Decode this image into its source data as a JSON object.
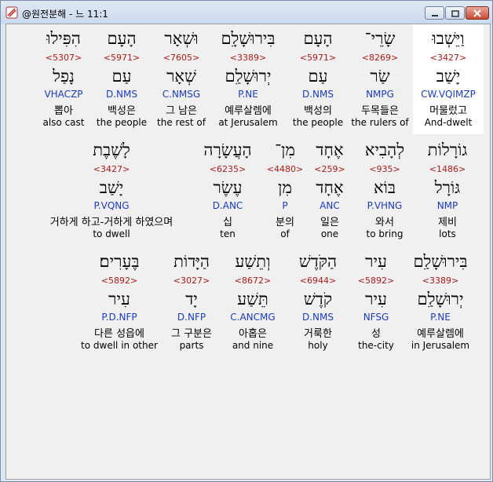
{
  "window": {
    "title": "@원전분해 - 느 11:1",
    "buttons": {
      "minimize": "minimize-icon",
      "maximize": "maximize-icon",
      "close": "close-icon"
    }
  },
  "colors": {
    "strong": "#b01818",
    "morph": "#1a3bc4",
    "selected_bg": "#ffffff",
    "content_bg": "#f0f0f0"
  },
  "rows": [
    {
      "words": [
        {
          "heb": "וַיֵּשְׁבוּ",
          "strong": "<3427>",
          "lemma": "יָשַׁב",
          "morph": "CW.VQIMZP",
          "korean": "머물렀고",
          "english": "And-dwelt",
          "selected": true
        },
        {
          "heb": "שָׂרֵי־",
          "strong": "<8269>",
          "lemma": "שַׂר",
          "morph": "NMPG",
          "korean": "두목들은",
          "english": "the rulers of"
        },
        {
          "heb": "הָעָם",
          "strong": "<5971>",
          "lemma": "עַם",
          "morph": "D.NMS",
          "korean": "백성의",
          "english": "the people"
        },
        {
          "heb": "בִּירוּשָׁלָ͏ִם",
          "strong": "<3389>",
          "lemma": "יְרוּשָׁלַ͏ִם",
          "morph": "P.NE",
          "korean": "예루살렘에",
          "english": "at Jerusalem"
        },
        {
          "heb": "וּשְׁאָר",
          "strong": "<7605>",
          "lemma": "שְׁאָר",
          "morph": "C.NMSG",
          "korean": "그 남은",
          "english": "the rest of"
        },
        {
          "heb": "הָעָם",
          "strong": "<5971>",
          "lemma": "עַם",
          "morph": "D.NMS",
          "korean": "백성은",
          "english": "the people"
        },
        {
          "heb": "הִפִּילוּ",
          "strong": "<5307>",
          "lemma": "נָפַל",
          "morph": "VHACZP",
          "korean": "뽑아",
          "english": "also cast"
        }
      ]
    },
    {
      "words": [
        {
          "heb": "גוֹרָלוֹת",
          "strong": "<1486>",
          "lemma": "גּוֹרָל",
          "morph": "NMP",
          "korean": "제비",
          "english": "lots"
        },
        {
          "heb": "לְהָבִיא",
          "strong": "<935>",
          "lemma": "בּוֹא",
          "morph": "P.VHNG",
          "korean": "와서",
          "english": "to bring"
        },
        {
          "heb": "אֶחָד",
          "strong": "<259>",
          "lemma": "אֶחָד",
          "morph": "ANC",
          "korean": "일은",
          "english": "one"
        },
        {
          "heb": "מִן־",
          "strong": "<4480>",
          "lemma": "מִן",
          "morph": "P",
          "korean": "분의",
          "english": "of"
        },
        {
          "heb": "הָעֲשָׂרָה",
          "strong": "<6235>",
          "lemma": "עֶשֶׂר",
          "morph": "D.ANC",
          "korean": "십",
          "english": "ten"
        },
        {
          "heb": "לָשֶׁבֶת",
          "strong": "<3427>",
          "lemma": "יָשַׁב",
          "morph": "P.VQNG",
          "korean": "거하게 하고-거하게 하였으며",
          "english": "to dwell"
        }
      ]
    },
    {
      "words": [
        {
          "heb": "בִּירוּשָׁלַ͏ִם",
          "strong": "<3389>",
          "lemma": "יְרוּשָׁלַ͏ִם",
          "morph": "P.NE",
          "korean": "예루살렘에",
          "english": "in Jerusalem"
        },
        {
          "heb": "עִיר",
          "strong": "<5892>",
          "lemma": "עִיר",
          "morph": "NFSG",
          "korean": "성",
          "english": "the-city"
        },
        {
          "heb": "הַקֹּדֶשׁ",
          "strong": "<6944>",
          "lemma": "קֹדֶשׁ",
          "morph": "D.NMS",
          "korean": "거룩한",
          "english": "holy"
        },
        {
          "heb": "וְתֵשַׁע",
          "strong": "<8672>",
          "lemma": "תֵּשַׁע",
          "morph": "C.ANCMG",
          "korean": "아홉은",
          "english": "and nine"
        },
        {
          "heb": "הַיָּדוֹת",
          "strong": "<3027>",
          "lemma": "יָד",
          "morph": "D.NFP",
          "korean": "그 구분은",
          "english": "parts"
        },
        {
          "heb": "בֶּעָרִים׃",
          "strong": "<5892>",
          "lemma": "עִיר",
          "morph": "P.D.NFP",
          "korean": "다른 성읍에",
          "english": "to dwell in other"
        }
      ]
    }
  ]
}
